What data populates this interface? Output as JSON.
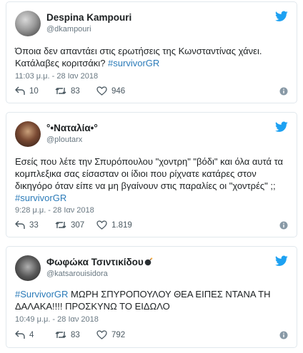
{
  "tweets": [
    {
      "name": "Despina Kampouri",
      "handle": "@dkampouri",
      "text_main": "Όποια δεν απαντάει στις ερωτήσεις της Κωνσταντίνας χάνει. Κατάλαβες κοριτσάκι? ",
      "hashtag": "#survivorGR",
      "time": "11:03 μ.μ. - 28 Ιαν 2018",
      "replies": "10",
      "retweets": "83",
      "likes": "946"
    },
    {
      "name": "°•Ναταλία•°",
      "handle": "@ploutarx",
      "text_main": "Εσείς που λέτε την Σπυρόπουλου \"χοντρη\" \"βόδι\" και όλα αυτά τα κομπλεξικα σας είσασταν οι ίδιοι που ρίχνατε κατάρες στον δικηγόρο όταν είπε να μη βγαίνουν στις παραλίες οι \"χοντρές\" ;; ",
      "hashtag": "#survivorGR",
      "time": "9:28 μ.μ. - 28 Ιαν 2018",
      "replies": "33",
      "retweets": "307",
      "likes": "1.819"
    },
    {
      "name": "Φωφώκα Τσιντικίδου",
      "handle": "@katsarouisidora",
      "hashtag": "#SurvivorGR",
      "text_main": " ΜΩΡΗ ΣΠΥΡΟΠΟΥΛΟΥ ΘΕΑ ΕΙΠΕΣ ΝΤΑΝΑ ΤΗ ΔΑΛΑΚΑ!!!! ΠΡΟΣΚΥΝΩ ΤΟ ΕΙΔΩΛΟ",
      "time": "10:49 μ.μ. - 28 Ιαν 2018",
      "replies": "4",
      "retweets": "83",
      "likes": "792"
    }
  ],
  "icons": {
    "bird": "twitter-bird-icon",
    "reply": "reply-icon",
    "retweet": "retweet-icon",
    "like": "heart-icon",
    "info": "info-icon",
    "bomb": "bomb-emoji-icon"
  },
  "colors": {
    "brand": "#1da1f2",
    "hashtag": "#2b7bb9",
    "muted": "#697882",
    "border": "#e1e8ed"
  }
}
